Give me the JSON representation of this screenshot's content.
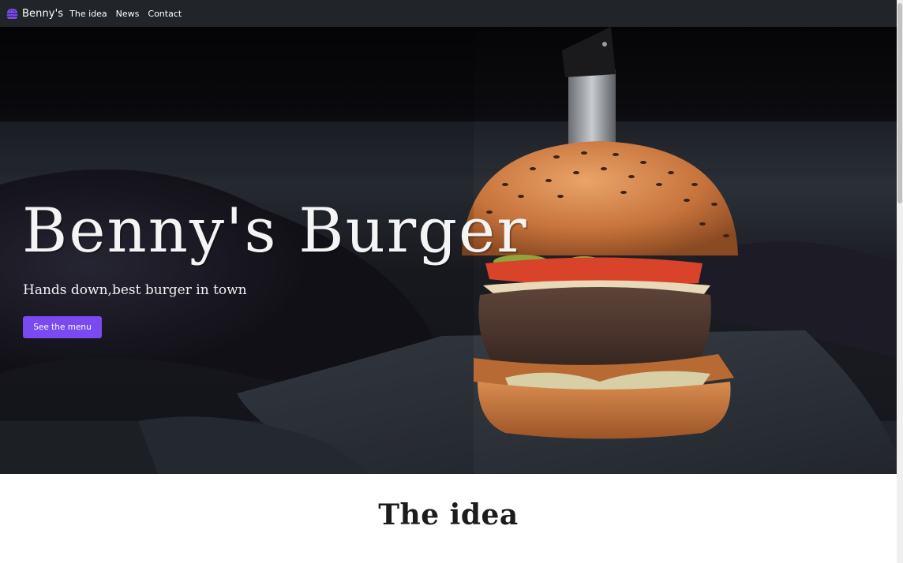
{
  "navbar": {
    "brand": "Benny's",
    "brand_icon": "burger-icon",
    "links": [
      {
        "label": "The idea"
      },
      {
        "label": "News"
      },
      {
        "label": "Contact"
      }
    ]
  },
  "hero": {
    "title": "Benny's Burger",
    "subtitle": "Hands down,best burger in town",
    "cta_label": "See the menu",
    "image": "burger-photo"
  },
  "idea": {
    "title": "The idea"
  },
  "colors": {
    "navbar_bg": "#212529",
    "accent": "#7a4af0"
  }
}
